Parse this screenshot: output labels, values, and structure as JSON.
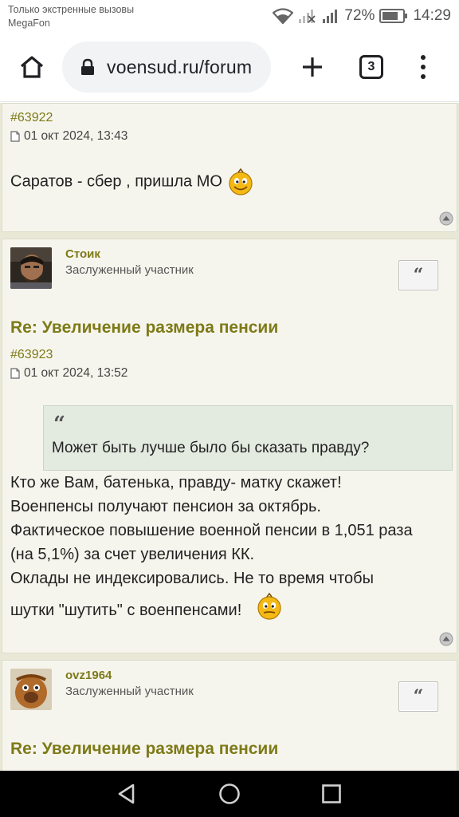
{
  "status_bar": {
    "carrier_line1": "Только экстренные вызовы",
    "carrier_line2": "MegaFon",
    "battery_percent": "72%",
    "time": "14:29"
  },
  "browser": {
    "url": "voensud.ru/forum",
    "tab_count": "3"
  },
  "posts": [
    {
      "number": "#63922",
      "date": "01 окт 2024, 13:43",
      "lines": [
        "Саратов - сбер , пришла МО"
      ]
    },
    {
      "username": "Стоик",
      "rank": "Заслуженный участник",
      "title": "Re: Увеличение размера пенсии",
      "number": "#63923",
      "date": "01 окт 2024, 13:52",
      "quote": "Может быть лучше было бы сказать правду?",
      "lines": [
        "Кто же Вам, батенька, правду- матку скажет!",
        "Военпенсы получают пенсион за октябрь.",
        "Фактическое повышение военной пенсии в 1,051 раза",
        "(на 5,1%) за счет увеличения КК.",
        "Оклады не индексировались. Не то время чтобы",
        "шутки \"шутить\" с военпенсами!"
      ]
    },
    {
      "username": "ovz1964",
      "rank": "Заслуженный участник",
      "title": "Re: Увеличение размера пенсии"
    }
  ],
  "quote_button_label": "“",
  "quote_mark": "“",
  "colors": {
    "link_olive": "#7d7a18",
    "post_bg": "#f6f5ed",
    "quote_bg": "#e3ebe0"
  }
}
